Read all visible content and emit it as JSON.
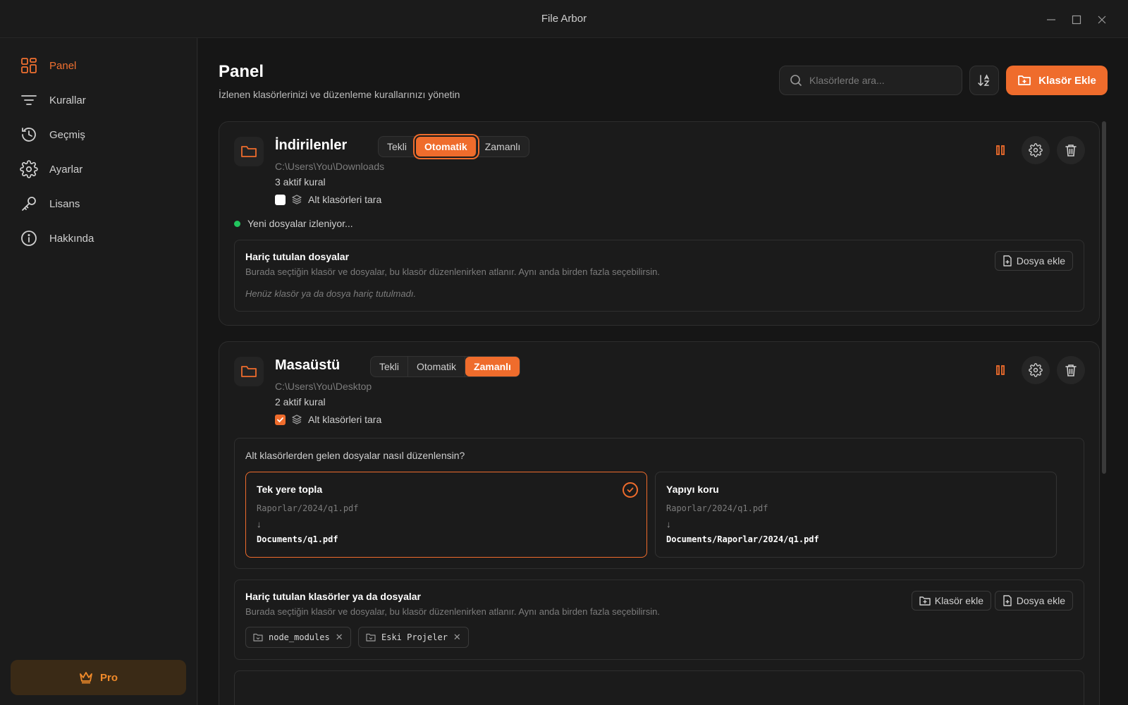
{
  "window": {
    "title": "File Arbor"
  },
  "sidebar": {
    "items": [
      {
        "label": "Panel",
        "icon": "dashboard-icon",
        "active": true
      },
      {
        "label": "Kurallar",
        "icon": "filter-icon"
      },
      {
        "label": "Geçmiş",
        "icon": "history-icon"
      },
      {
        "label": "Ayarlar",
        "icon": "gear-icon"
      },
      {
        "label": "Lisans",
        "icon": "key-icon"
      },
      {
        "label": "Hakkında",
        "icon": "info-icon"
      }
    ],
    "pro_label": "Pro"
  },
  "header": {
    "title": "Panel",
    "subtitle": "İzlenen klasörlerinizi ve düzenleme kurallarınızı yönetin",
    "search_placeholder": "Klasörlerde ara...",
    "add_folder_label": "Klasör Ekle"
  },
  "accent": "#ef6c2c",
  "folders": [
    {
      "name": "İndirilenler",
      "modes": [
        "Tekli",
        "Otomatik",
        "Zamanlı"
      ],
      "active_mode": "Otomatik",
      "path": "C:\\Users\\You\\Downloads",
      "rules": "3 aktif kural",
      "subfolder_scan_label": "Alt klasörleri tara",
      "subfolder_scan": false,
      "status": "Yeni dosyalar izleniyor...",
      "excluded": {
        "title": "Hariç tutulan dosyalar",
        "description": "Burada seçtiğin klasör ve dosyalar, bu klasör düzenlenirken atlanır. Aynı anda birden fazla seçebilirsin.",
        "empty": "Henüz klasör ya da dosya hariç tutulmadı.",
        "add_file_label": "Dosya ekle"
      }
    },
    {
      "name": "Masaüstü",
      "modes": [
        "Tekli",
        "Otomatik",
        "Zamanlı"
      ],
      "active_mode": "Zamanlı",
      "path": "C:\\Users\\You\\Desktop",
      "rules": "2 aktif kural",
      "subfolder_scan_label": "Alt klasörleri tara",
      "subfolder_scan": true,
      "subfolder_question": "Alt klasörlerden gelen dosyalar nasıl düzenlensin?",
      "options": [
        {
          "title": "Tek yere topla",
          "src": "Raporlar/2024/q1.pdf",
          "arrow": "↓",
          "dst": "Documents/q1.pdf",
          "selected": true
        },
        {
          "title": "Yapıyı koru",
          "src": "Raporlar/2024/q1.pdf",
          "arrow": "↓",
          "dst": "Documents/Raporlar/2024/q1.pdf",
          "selected": false
        }
      ],
      "excluded": {
        "title": "Hariç tutulan klasörler ya da dosyalar",
        "description": "Burada seçtiğin klasör ve dosyalar, bu klasör düzenlenirken atlanır. Aynı anda birden fazla seçebilirsin.",
        "add_folder_label": "Klasör ekle",
        "add_file_label": "Dosya ekle",
        "items": [
          "node_modules",
          "Eski Projeler"
        ]
      }
    }
  ]
}
